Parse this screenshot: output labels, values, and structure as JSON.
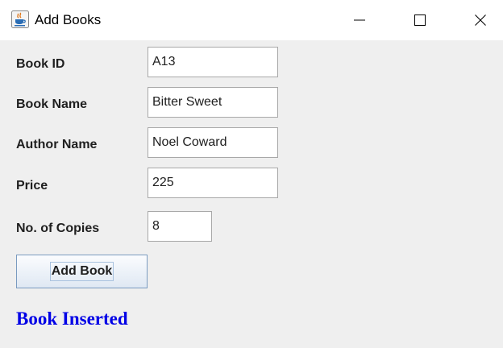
{
  "window": {
    "title": "Add Books",
    "icon": "java-cup-icon",
    "controls": [
      "minimize-icon",
      "maximize-icon",
      "close-icon"
    ]
  },
  "form": {
    "fields": [
      {
        "label": "Book ID",
        "value": "A13"
      },
      {
        "label": "Book Name",
        "value": "Bitter Sweet"
      },
      {
        "label": "Author Name",
        "value": "Noel Coward"
      },
      {
        "label": "Price",
        "value": "225"
      },
      {
        "label": "No. of Copies",
        "value": "8"
      }
    ],
    "submit_label": "Add Book"
  },
  "status": {
    "message": "Book Inserted",
    "color": "#0000e6"
  }
}
